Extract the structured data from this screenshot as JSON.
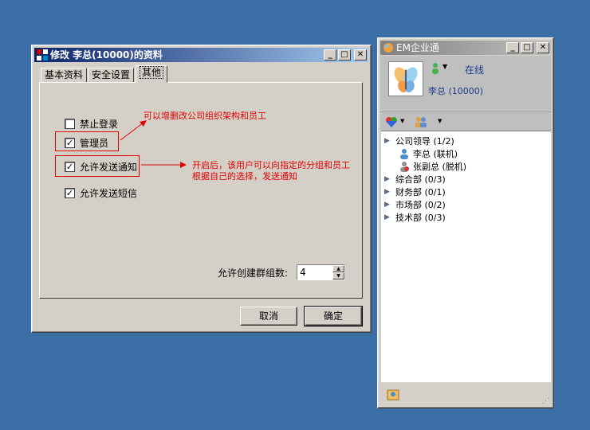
{
  "dialog": {
    "title": "修改 李总(10000)的资料",
    "tabs": [
      "基本资料",
      "安全设置",
      "其他"
    ],
    "checkboxes": {
      "disable_login": {
        "label": "禁止登录",
        "checked": false
      },
      "admin": {
        "label": "管理员",
        "checked": true
      },
      "allow_notice": {
        "label": "允许发送通知",
        "checked": true
      },
      "allow_sms": {
        "label": "允许发送短信",
        "checked": true
      }
    },
    "annotation_admin": "可以增删改公司组织架构和员工",
    "annotation_notice_1": "开启后，该用户可以向指定的分组和员工",
    "annotation_notice_2": "根据自己的选择，发送通知",
    "group_limit_label": "允许创建群组数:",
    "group_limit_value": "4",
    "cancel_label": "取消",
    "ok_label": "确定"
  },
  "em": {
    "title": "EM企业通",
    "status": "在线",
    "user_name": "李总 (10000)",
    "tree": [
      {
        "label": "公司领导 (1/2)",
        "type": "group"
      },
      {
        "label": "李总 (联机)",
        "type": "member",
        "online": true
      },
      {
        "label": "张副总 (脱机)",
        "type": "member",
        "online": false
      },
      {
        "label": "综合部 (0/3)",
        "type": "group"
      },
      {
        "label": "财务部 (0/1)",
        "type": "group"
      },
      {
        "label": "市场部 (0/2)",
        "type": "group"
      },
      {
        "label": "技术部 (0/3)",
        "type": "group"
      }
    ]
  }
}
